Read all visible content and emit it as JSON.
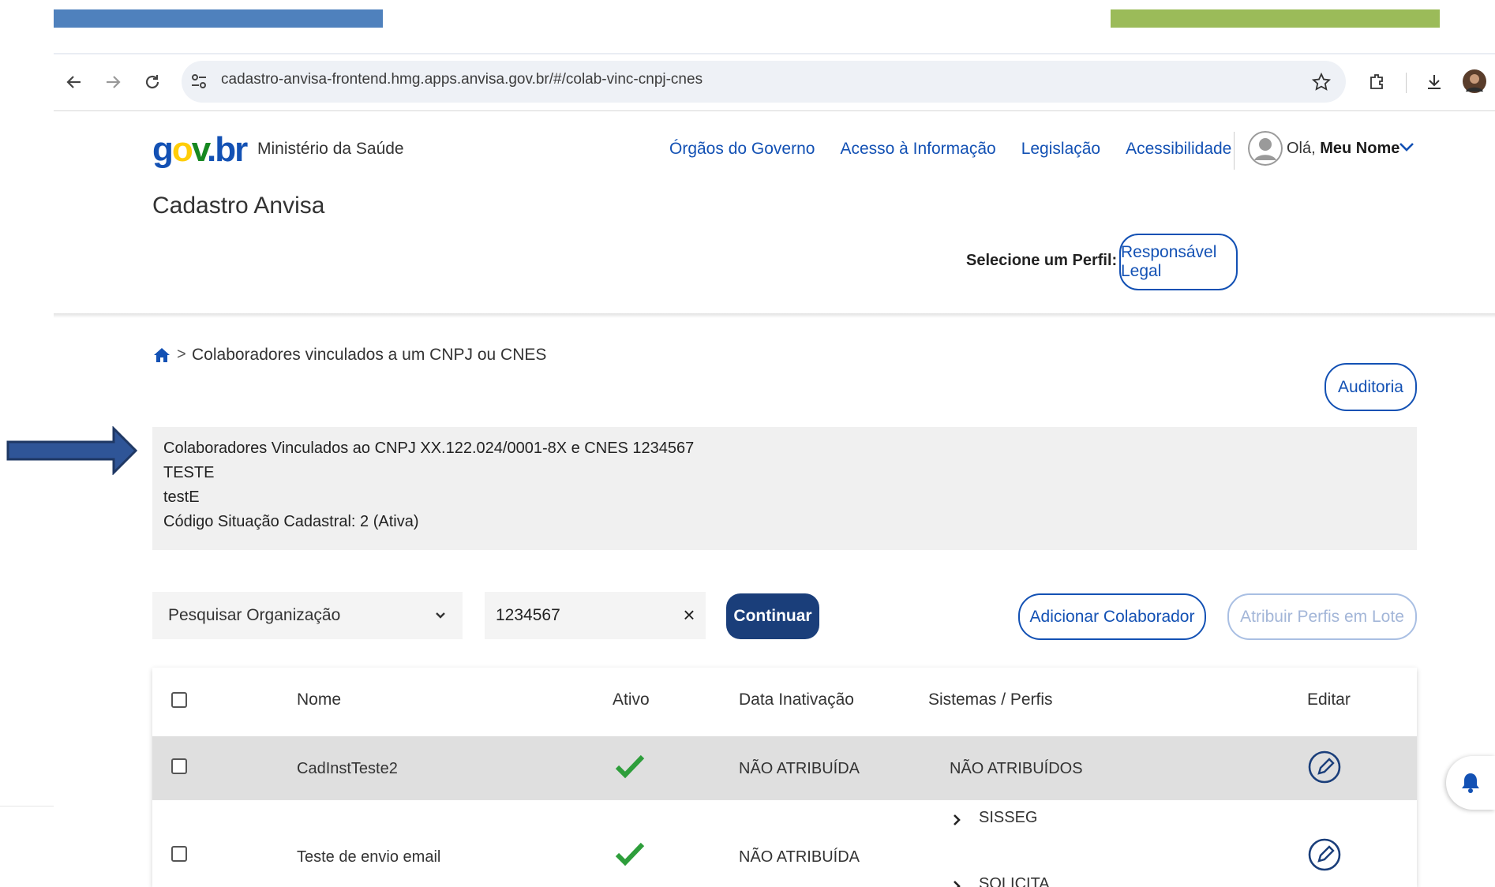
{
  "browser": {
    "url": "cadastro-anvisa-frontend.hmg.apps.anvisa.gov.br/#/colab-vinc-cnpj-cnes"
  },
  "header": {
    "logo": {
      "g": "g",
      "o": "o",
      "v": "v",
      "dot": ".",
      "b": "br"
    },
    "ministry": "Ministério da Saúde",
    "links": [
      "Órgãos do Governo",
      "Acesso à Informação",
      "Legislação",
      "Acessibilidade"
    ],
    "greeting": "Olá,",
    "user_name": "Meu Nome",
    "app_title": "Cadastro Anvisa",
    "profile_label": "Selecione um Perfil:",
    "profile_value": "Responsável Legal"
  },
  "breadcrumb": {
    "separator": ">",
    "current": "Colaboradores vinculados a um CNPJ ou CNES"
  },
  "actions": {
    "auditoria": "Auditoria",
    "continuar": "Continuar",
    "adicionar": "Adicionar Colaborador",
    "atribuir": "Atribuir Perfis em Lote"
  },
  "info": {
    "line1": "Colaboradores Vinculados ao CNPJ XX.122.024/0001-8X e CNES 1234567",
    "line2": "TESTE",
    "line3": "testE",
    "line4": "Código Situação Cadastral: 2 (Ativa)"
  },
  "search": {
    "select_value": "Pesquisar Organização",
    "input_value": "1234567",
    "clear": "×"
  },
  "table": {
    "headers": {
      "nome": "Nome",
      "ativo": "Ativo",
      "data": "Data Inativação",
      "sistemas": "Sistemas / Perfis",
      "editar": "Editar"
    },
    "rows": [
      {
        "nome": "CadInstTeste2",
        "data": "NÃO ATRIBUÍDA",
        "sistemas": "NÃO ATRIBUÍDOS"
      },
      {
        "nome": "Teste de envio email",
        "data": "NÃO ATRIBUÍDA",
        "sistemas": [
          "SISSEG",
          "SOLICITA"
        ]
      }
    ]
  },
  "colors": {
    "accent": "#1351b4",
    "primary_button": "#1a3e7a",
    "active_check": "#2e9e3b"
  }
}
